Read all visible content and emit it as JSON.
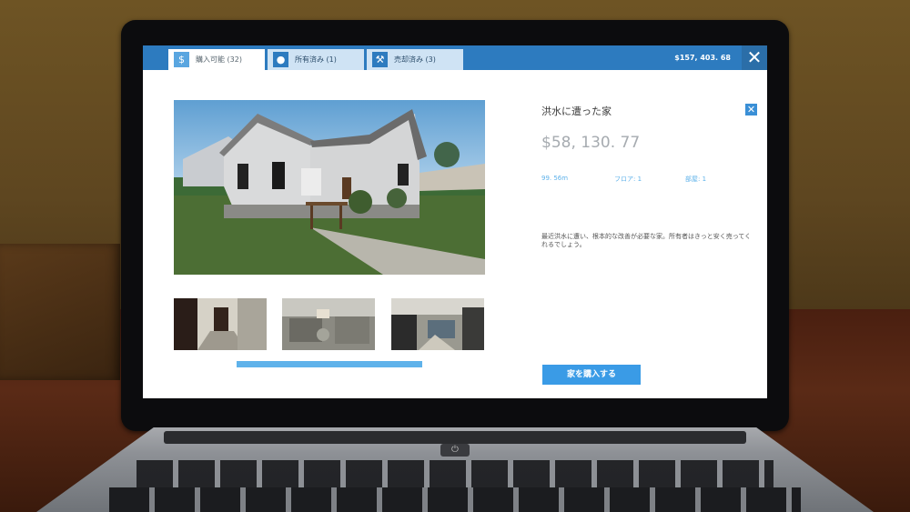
{
  "tabs": [
    {
      "label": "購入可能 (32)",
      "icon": "dollar-house-icon"
    },
    {
      "label": "所有済み (1)",
      "icon": "person-icon"
    },
    {
      "label": "売却済み (3)",
      "icon": "gavel-icon"
    }
  ],
  "balance": "$157, 403. 68",
  "close_glyph": "✕",
  "listing": {
    "title": "洪水に遭った家",
    "price": "$58, 130. 77",
    "area": "99. 56m",
    "floors": "フロア: 1",
    "rooms": "部屋: 1",
    "description": "最近洪水に遭い、根本的な改善が必要な家。所有者はきっと安く売ってくれるでしょう。",
    "buy_label": "家を購入する"
  },
  "colors": {
    "accent": "#2d7bbf",
    "button": "#3a9be6",
    "stat_text": "#5fb2ea"
  }
}
